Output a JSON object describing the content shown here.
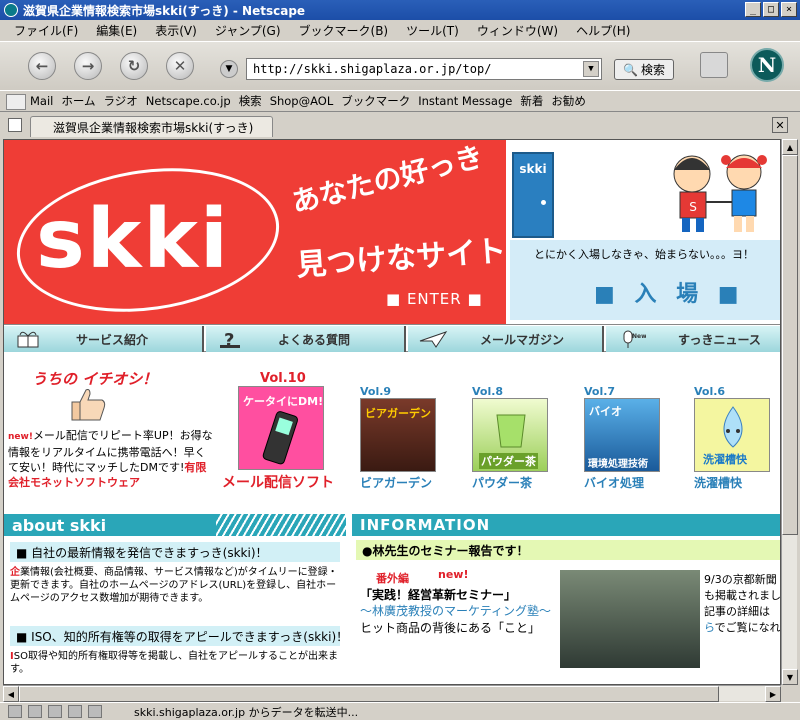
{
  "window": {
    "title": "滋賀県企業情報検索市場skki(すっき) - Netscape",
    "buttons": [
      "_",
      "□",
      "×"
    ]
  },
  "menu": [
    "ファイル(F)",
    "編集(E)",
    "表示(V)",
    "ジャンプ(G)",
    "ブックマーク(B)",
    "ツール(T)",
    "ウィンドウ(W)",
    "ヘルプ(H)"
  ],
  "navbar": {
    "url": "http://skki.shigaplaza.or.jp/top/",
    "search_label": "検索"
  },
  "personal_toolbar": [
    "Mail",
    "ホーム",
    "ラジオ",
    "Netscape.co.jp",
    "検索",
    "Shop@AOL",
    "ブックマーク",
    "Instant Message",
    "新着",
    "お勧め"
  ],
  "tab": {
    "title": "滋賀県企業情報検索市場skki(すっき)"
  },
  "status": {
    "text": "skki.shigaplaza.or.jp からデータを転送中..."
  },
  "banner": {
    "logo": "skki",
    "catch1": "あなたの好っき",
    "catch2": "見つけなサイト。",
    "enter": "■ ENTER ■",
    "door_label": "skki",
    "entry_message": "とにかく入場しなきゃ、始まらない。。。ヨ！",
    "entry_button": "■ 入 場 ■"
  },
  "nav_strip": [
    "サービス紹介",
    "よくある質問",
    "メールマガジン",
    "すっきニュース"
  ],
  "pickup": {
    "title": "うちの イチオシ！",
    "new_tag": "new!",
    "text": "メール配信でリピート率UP！お得な情報をリアルタイムに携帯電話へ！早くて安い！時代にマッチしたDMです!",
    "company": "有限会社モネットソフトウェア"
  },
  "volumes": [
    {
      "vol": "Vol.10",
      "caption": "メール配信ソフト",
      "img_text": "ケータイにDM!"
    },
    {
      "vol": "Vol.9",
      "caption": "ビアガーデン",
      "img_text": "ビアガーデン"
    },
    {
      "vol": "Vol.8",
      "caption": "パウダー茶",
      "img_text": "パウダー茶"
    },
    {
      "vol": "Vol.7",
      "caption": "バイオ処理",
      "img_text": "環境処理技術"
    },
    {
      "vol": "Vol.6",
      "caption": "洗濯槽快",
      "img_text": "洗濯槽快"
    }
  ],
  "about": {
    "title": "about skki",
    "section1": "■ 自社の最新情報を発信できますっき(skki)！",
    "body1_red": "企",
    "body1": "業情報(会社概要、商品情報、サービス情報など)がタイムリーに登録・更新できます。自社のホームページのアドレス(URL)を登録し、自社ホームページのアクセス数増加が期待できます。",
    "section2": "■ ISO、知的所有権等の取得をアピールできますっき(skki)！",
    "body2_red": "I",
    "body2": "SO取得や知的所有権取得等を掲載し、自社をアピールすることが出来ます。"
  },
  "information": {
    "title": "INFORMATION",
    "headline": "●林先生のセミナー報告です！",
    "kind": "番外編",
    "new_tag": "new!",
    "title1": "「実践！経営革新セミナー」",
    "title2": "〜林廣茂教授のマーケティング塾〜",
    "title3": "ヒット商品の背後にある「こと」",
    "side1": "9/3の京都新聞",
    "side2": "も掲載されまし",
    "side3": "記事の詳細は",
    "side4_link": "ら",
    "side4": "でご覧になれま"
  }
}
